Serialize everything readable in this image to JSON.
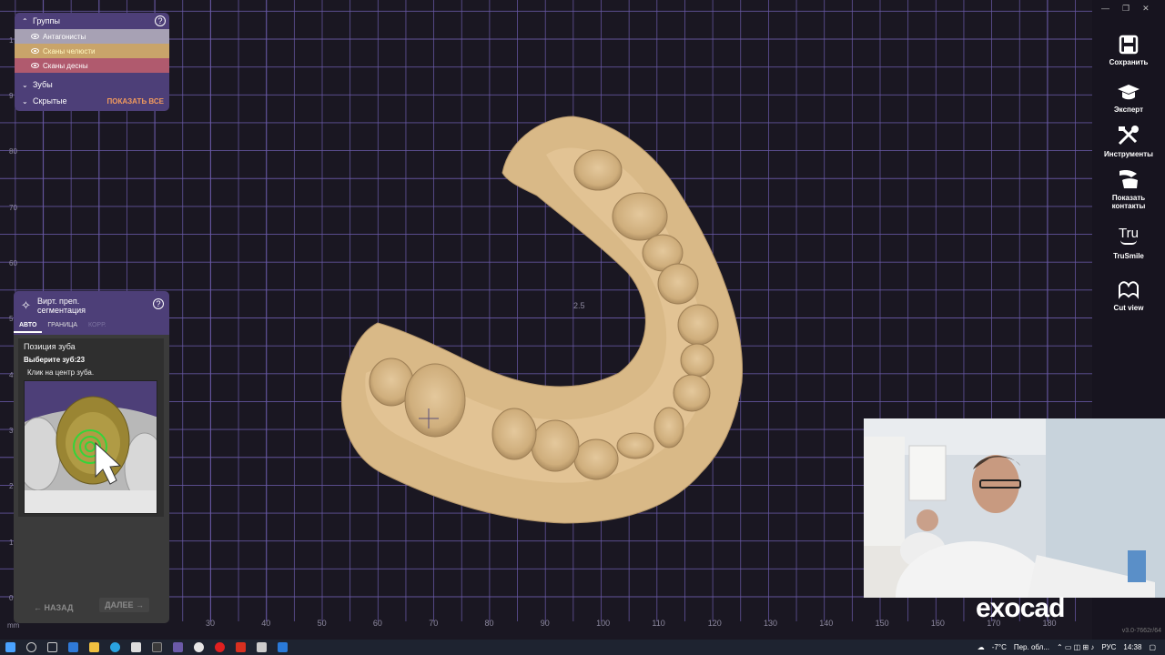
{
  "groups_panel": {
    "title": "Группы",
    "items": [
      {
        "label": "Антагонисты",
        "visible": true
      },
      {
        "label": "Сканы челюсти",
        "visible": true
      },
      {
        "label": "Сканы десны",
        "visible": true
      }
    ],
    "teeth_label": "Зубы",
    "hidden_label": "Скрытые",
    "show_all_label": "ПОКАЗАТЬ ВСЕ"
  },
  "segmentation_panel": {
    "title_line1": "Вирт. преп.",
    "title_line2": "сегментация",
    "tabs": [
      {
        "label": "АВТО",
        "state": "active"
      },
      {
        "label": "ГРАНИЦА",
        "state": "normal"
      },
      {
        "label": "КОРР.",
        "state": "disabled"
      }
    ],
    "section_title": "Позиция зуба",
    "instruction": "Выберите зуб:23",
    "hint": "Клик на центр зуба.",
    "back_label": "НАЗАД",
    "next_label": "ДАЛЕЕ"
  },
  "viewport": {
    "center_label": "2.5",
    "unit_label": "mm",
    "x_ticks": [
      "30",
      "40",
      "50",
      "60",
      "70",
      "80",
      "90",
      "100",
      "110",
      "120",
      "130",
      "140",
      "150",
      "160",
      "170",
      "180"
    ],
    "y_ticks": [
      "80",
      "70",
      "60",
      "5",
      "4",
      "3",
      "2",
      "1",
      "0"
    ],
    "y_ticks_top": [
      "1",
      "9"
    ]
  },
  "toolbar": {
    "items": [
      {
        "label": "Сохранить",
        "icon": "save-icon"
      },
      {
        "label": "Эксперт",
        "icon": "graduation-cap-icon"
      },
      {
        "label": "Инструменты",
        "icon": "tools-icon"
      },
      {
        "label": "Показать контакты",
        "icon": "contacts-icon"
      },
      {
        "label": "TruSmile",
        "icon": "trusmile-icon"
      },
      {
        "label": "Cut view",
        "icon": "cut-view-icon"
      }
    ],
    "trusmile_mark": "Tru",
    "version": "v3.0-7662r/64"
  },
  "brand": {
    "logo": "exocad"
  },
  "taskbar": {
    "weather": "-7°C",
    "weather_text": "Пер. обл...",
    "language": "РУС",
    "time": "14:38"
  },
  "colors": {
    "panel_purple": "#4d3f78",
    "grid_line": "#6a5aa8",
    "model_tan": "#d8b98a",
    "accent_orange": "#f39b5d"
  }
}
